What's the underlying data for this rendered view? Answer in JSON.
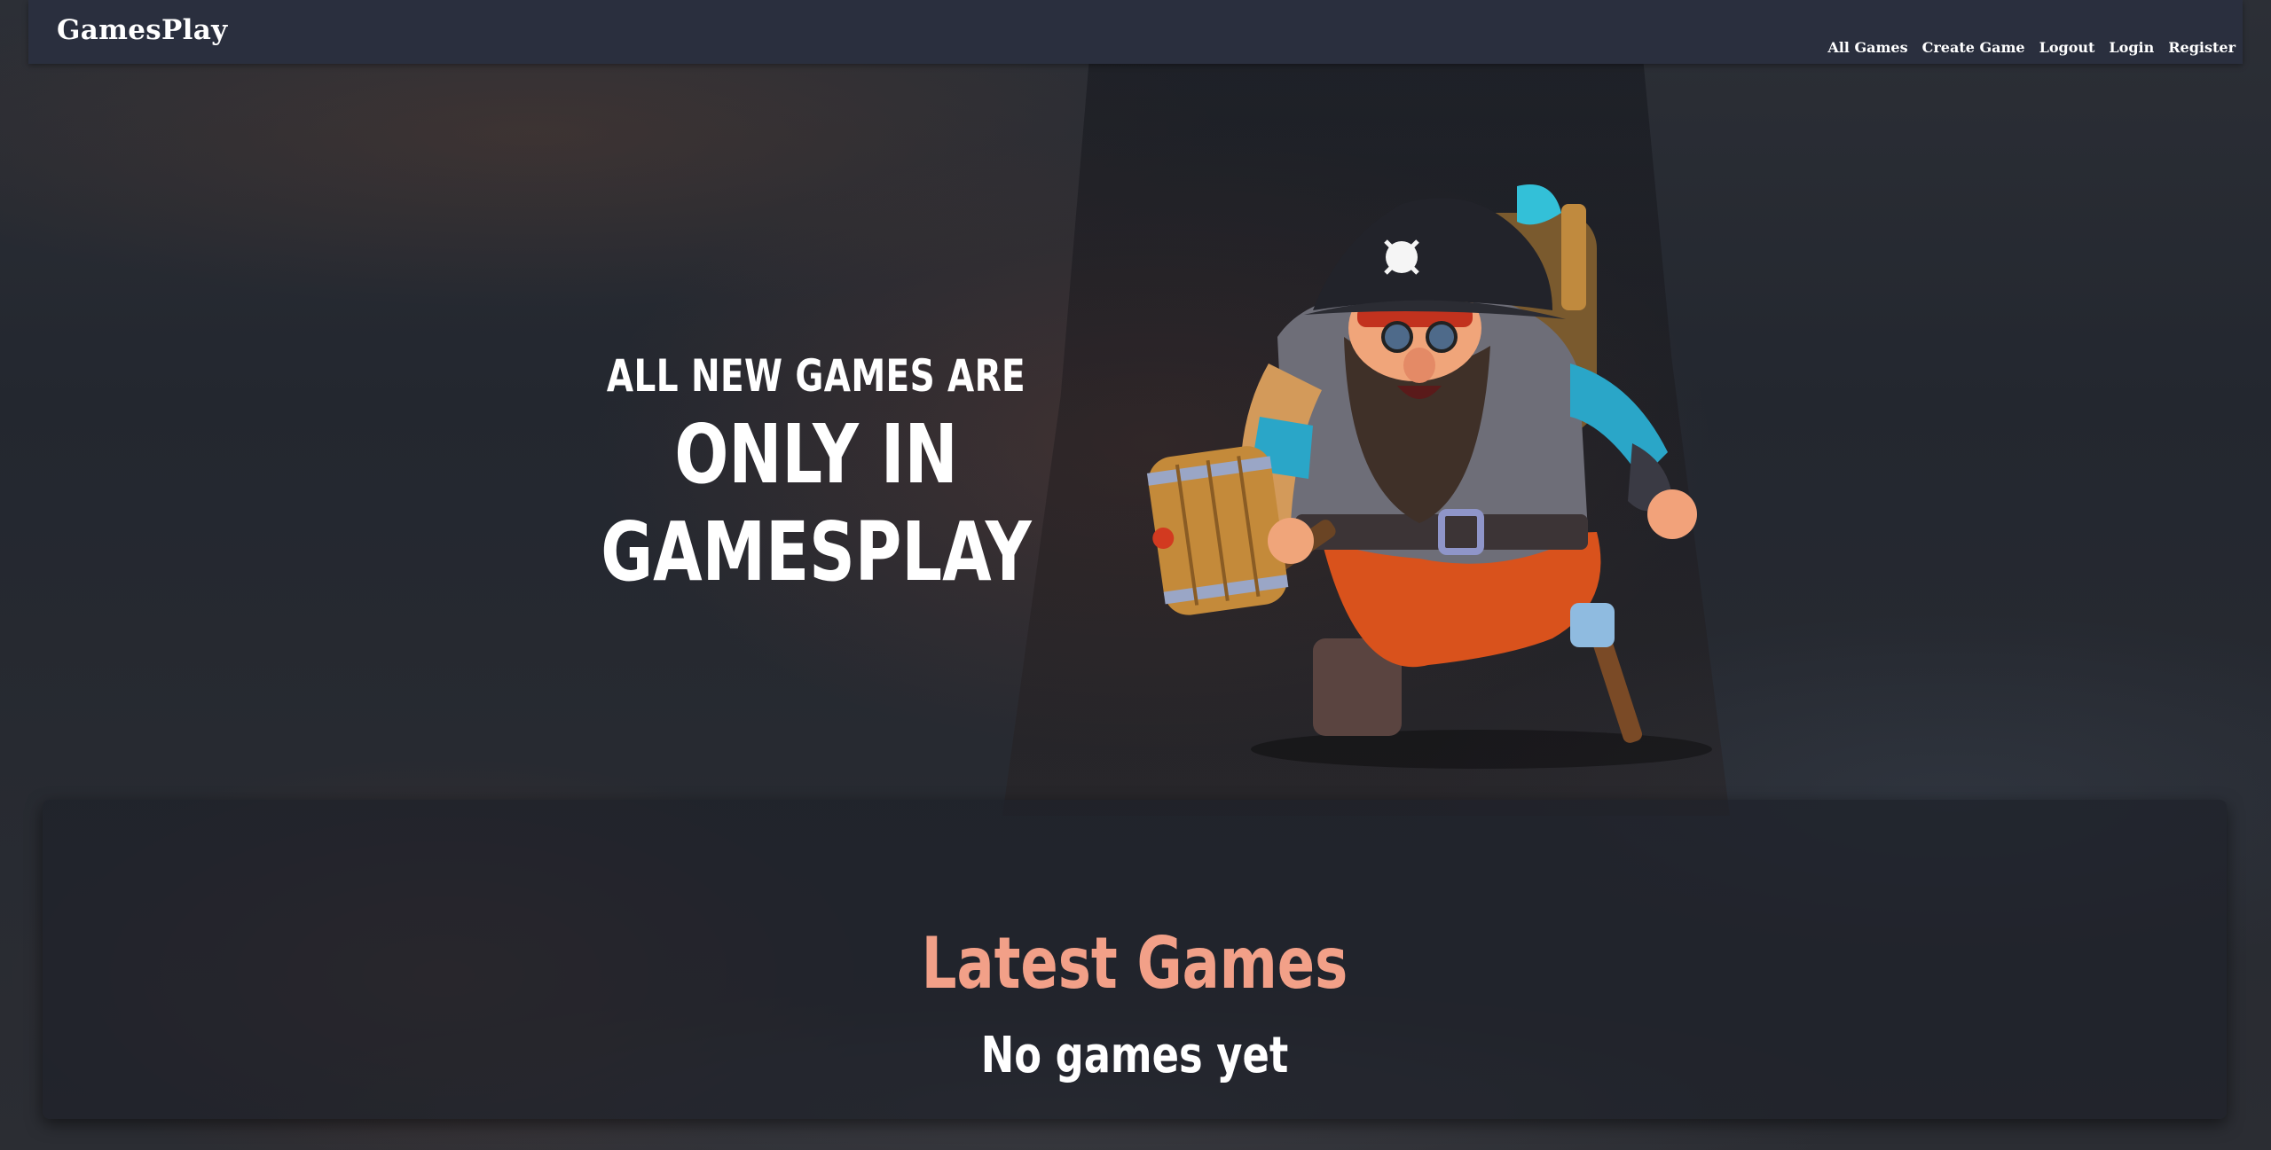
{
  "nav": {
    "brand": "GamesPlay",
    "links": [
      "All Games",
      "Create Game",
      "Logout",
      "Login",
      "Register"
    ]
  },
  "hero": {
    "line_1": "ALL NEW GAMES ARE",
    "line_2": "ONLY IN GAMESPLAY",
    "image": "pirate-dwarf-character-illustration"
  },
  "latest": {
    "title": "Latest Games",
    "empty_message": "No games yet"
  },
  "colors": {
    "navbar": "#2a2f3e",
    "accent_title": "#f2a088",
    "text": "#ffffff"
  }
}
